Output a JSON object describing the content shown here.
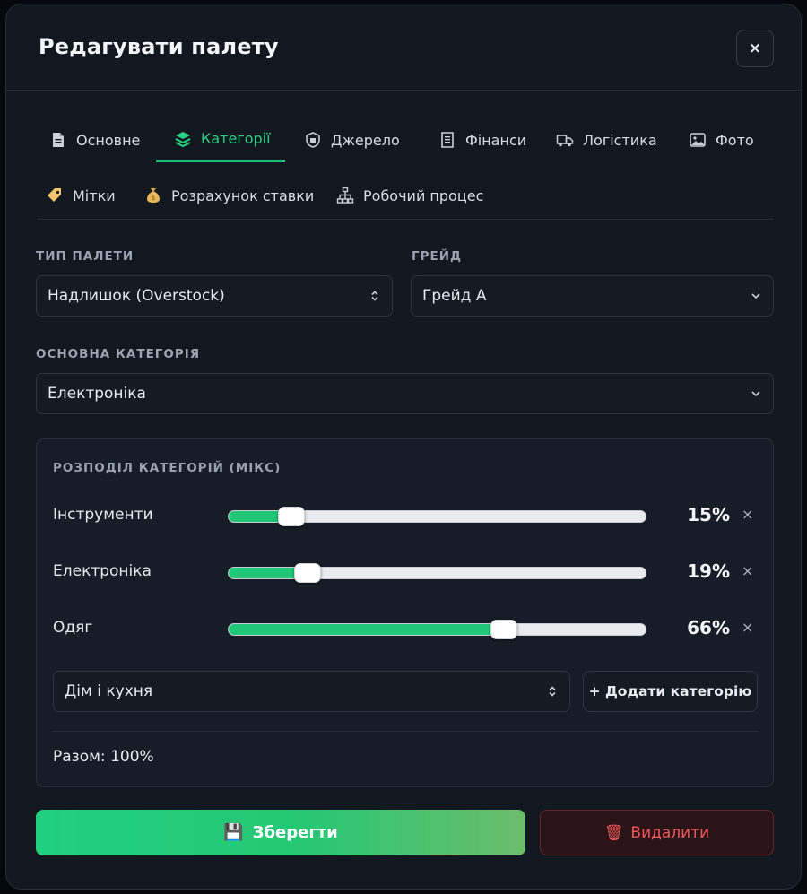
{
  "modal": {
    "title": "Редагувати палету",
    "close": "×"
  },
  "tabs": [
    {
      "label": "Основне",
      "icon": "file-icon",
      "active": false
    },
    {
      "label": "Категорії",
      "icon": "layers-icon",
      "active": true
    },
    {
      "label": "Джерело",
      "icon": "shield-icon",
      "active": false
    },
    {
      "label": "Фінанси",
      "icon": "receipt-icon",
      "active": false
    },
    {
      "label": "Логістика",
      "icon": "truck-icon",
      "active": false
    },
    {
      "label": "Фото",
      "icon": "image-icon",
      "active": false
    },
    {
      "label": "Мітки",
      "icon": "tag-icon",
      "active": false
    },
    {
      "label": "Розрахунок ставки",
      "icon": "money-bag-icon",
      "active": false
    },
    {
      "label": "Робочий процес",
      "icon": "sitemap-icon",
      "active": false
    }
  ],
  "fields": {
    "pallet_type": {
      "label": "ТИП ПАЛЕТИ",
      "value": "Надлишок (Overstock)"
    },
    "grade": {
      "label": "ГРЕЙД",
      "value": "Грейд А"
    },
    "main_category": {
      "label": "ОСНОВНА КАТЕГОРІЯ",
      "value": "Електроніка"
    }
  },
  "mix": {
    "title": "РОЗПОДІЛ КАТЕГОРІЙ (МІКС)",
    "rows": [
      {
        "name": "Інструменти",
        "percent": 15,
        "percent_label": "15%",
        "remove": "×"
      },
      {
        "name": "Електроніка",
        "percent": 19,
        "percent_label": "19%",
        "remove": "×"
      },
      {
        "name": "Одяг",
        "percent": 66,
        "percent_label": "66%",
        "remove": "×"
      }
    ],
    "new_category_select": "Дім і кухня",
    "add_button": "+ Додати категорію",
    "total": "Разом: 100%"
  },
  "actions": {
    "save": "Зберегти",
    "save_icon": "💾",
    "delete": "Видалити",
    "delete_icon": "🗑"
  },
  "colors": {
    "accent": "#22c773",
    "danger": "#f05a5a",
    "background": "#121820"
  }
}
